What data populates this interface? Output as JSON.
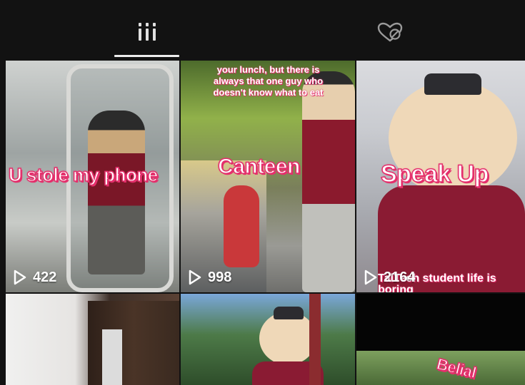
{
  "tabs": {
    "videos": {
      "icon": "grid-videos-icon",
      "active": true
    },
    "liked": {
      "icon": "liked-hidden-icon",
      "active": false
    }
  },
  "colors": {
    "background": "#121212",
    "indicator": "#ededed",
    "caption_outline": "#e4306c"
  },
  "tiles": [
    {
      "caption": "U stole my phone",
      "views": "422",
      "overlay": ""
    },
    {
      "caption": "Canteen",
      "views": "998",
      "overlay": "your lunch, but there is always that one guy who doesn't know what to eat"
    },
    {
      "caption": "Speak Up",
      "views": "2164",
      "overlay": "TalTech student life is boring"
    },
    {
      "caption": "",
      "views": "",
      "overlay": ""
    },
    {
      "caption": "",
      "views": "",
      "overlay": ""
    },
    {
      "caption": "Belial",
      "views": "",
      "overlay": ""
    }
  ]
}
